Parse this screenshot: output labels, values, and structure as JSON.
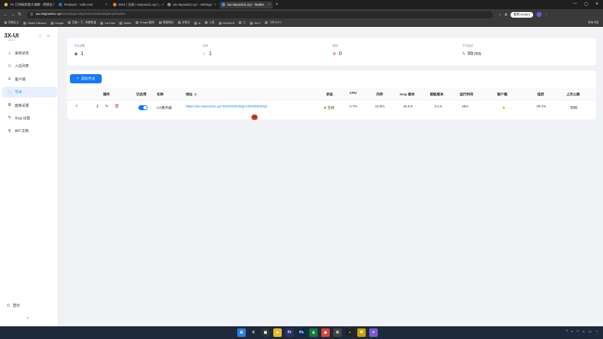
{
  "browser": {
    "tabs": [
      {
        "title": "TK 订阅帐款套大满解 - 把病石",
        "color": "#e0b74d",
        "active": false
      },
      {
        "title": "Products - Vultr.com",
        "color": "#2a6cd8",
        "active": false
      },
      {
        "title": "DNS | 记录 | naiyou011.xyz | ...",
        "color": "#f48120",
        "active": false
      },
      {
        "title": "aa.naiyou011.xyz - Settings",
        "color": "#888888",
        "active": false
      },
      {
        "title": "aa.naiyou011.xyz - Nodes",
        "color": "#4a8cff",
        "active": true
      }
    ],
    "url_host": "aa.naiyou011.xyz",
    "url_rest": ":8443/yqcA4QJmDmXG8tot6/panel/nodes",
    "gemini_label": "使用 Gemini",
    "bookmarks": [
      "把病石士",
      "Stable Diffusion",
      "Google",
      "百度一下，你就知道",
      "YouTube",
      "Netflix",
      "Google 翻译",
      "视频网站",
      "学知识",
      "ai",
      "工具",
      "iMovieOS",
      "工",
      "3ALV",
      "飞书·SV71"
    ],
    "all_bookmarks": "所有书签"
  },
  "sidebar": {
    "brand": "3X-UI",
    "version": "v3.3.1",
    "items": [
      {
        "label": "系统状态",
        "icon": "dashboard-icon",
        "glyph": "⌂",
        "active": false
      },
      {
        "label": "入站列表",
        "icon": "user-icon",
        "glyph": "⚇",
        "active": false
      },
      {
        "label": "客户端",
        "icon": "team-icon",
        "glyph": "♙",
        "active": false
      },
      {
        "label": "节点",
        "icon": "cluster-icon",
        "glyph": "⬚",
        "active": true
      },
      {
        "label": "面板设置",
        "icon": "settings-icon",
        "glyph": "⚙",
        "active": false
      },
      {
        "label": "Xray 设置",
        "icon": "tool-icon",
        "glyph": "✎",
        "active": false
      },
      {
        "label": "API 文档",
        "icon": "api-icon",
        "glyph": "⚲",
        "active": false
      }
    ],
    "logout": "登出"
  },
  "stats": [
    {
      "label": "节点总数",
      "value": "1",
      "icon": "eye-icon",
      "glyph": "◉",
      "color": "#555555"
    },
    {
      "label": "在线",
      "value": "1",
      "icon": "check-circle-icon",
      "glyph": "✓",
      "color": "#d4a017"
    },
    {
      "label": "离线",
      "value": "0",
      "icon": "close-circle-icon",
      "glyph": "⊗",
      "color": "#e5484d"
    },
    {
      "label": "平均延迟",
      "value": "99 ms",
      "icon": "thunder-icon",
      "glyph": "ϟ",
      "color": "#555555"
    }
  ],
  "table": {
    "add_button": "添加节点",
    "headers": {
      "actions": "操作",
      "enabled": "已启用",
      "name": "名称",
      "address": "地址",
      "status": "状态",
      "cpu": "CPU",
      "memory": "内存",
      "xray_version": "Xray 版本",
      "panel_version": "面板版本",
      "uptime": "运行时间",
      "clients": "客户端",
      "latency": "延迟",
      "last_heartbeat": "上次心跳"
    },
    "rows": [
      {
        "enabled": true,
        "name": "US服务器",
        "address": "https://aa.naiyou011.xyz:8443/zhlcnlegYL9hzW5rl3eg/",
        "status": "在线",
        "cpu": "0.7%",
        "memory": "12.8%",
        "xray_version": "26.5.9",
        "panel_version": "3.1.0",
        "uptime": "46m",
        "latency": "99 ms",
        "last_heartbeat": "刚刚"
      }
    ]
  }
}
